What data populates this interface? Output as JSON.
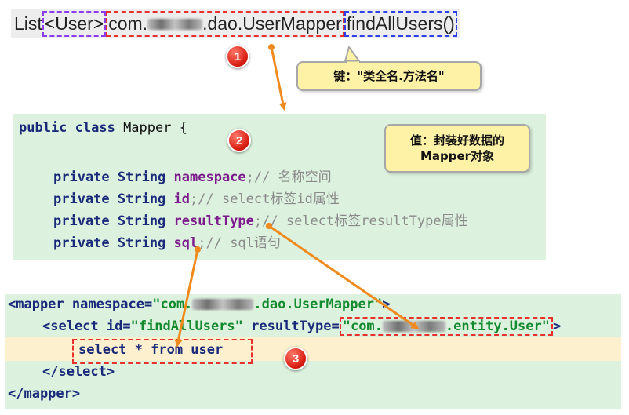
{
  "signature": {
    "return_prefix": "List",
    "return_generic": "<User>",
    "class_prefix": "com.",
    "class_suffix": ".dao.UserMapper",
    "method": "findAllUsers()"
  },
  "steps": [
    "1",
    "2",
    "3"
  ],
  "callouts": {
    "key": "键：\"类全名.方法名\"",
    "value_line1": "值：封装好数据的",
    "value_line2": "Mapper对象"
  },
  "java": {
    "class_decl_kw": "public class",
    "class_decl_rest": " Mapper {",
    "fields": [
      {
        "kw": "private String ",
        "name": "namespace",
        "comment": ";// 名称空间"
      },
      {
        "kw": "private String ",
        "name": "id",
        "comment": ";// select标签id属性"
      },
      {
        "kw": "private String ",
        "name": "resultType",
        "comment": ";// select标签resultType属性"
      },
      {
        "kw": "private String ",
        "name": "sql",
        "comment": ";// sql语句"
      }
    ]
  },
  "xml": {
    "mapper_open_tag": "<mapper namespace=",
    "mapper_ns_prefix": "\"com.",
    "mapper_ns_suffix": ".dao.UserMapper\"",
    "mapper_open_end": ">",
    "select_open": "<select id=",
    "select_id": "\"findAllUsers\"",
    "result_attr": " resultType=",
    "result_prefix": "\"com.",
    "result_suffix": ".entity.User\"",
    "select_open_end": ">",
    "sql": "select * from user",
    "select_close": "</select>",
    "mapper_close": "</mapper>"
  },
  "colors": {
    "panel_green": "#dcf1de",
    "highlight_yellow": "#fdf0cf",
    "arrow_orange": "#f08a1c",
    "dash_red": "#e8302d",
    "dash_blue": "#2d3fe8",
    "dash_purple": "#8a3cf0"
  }
}
